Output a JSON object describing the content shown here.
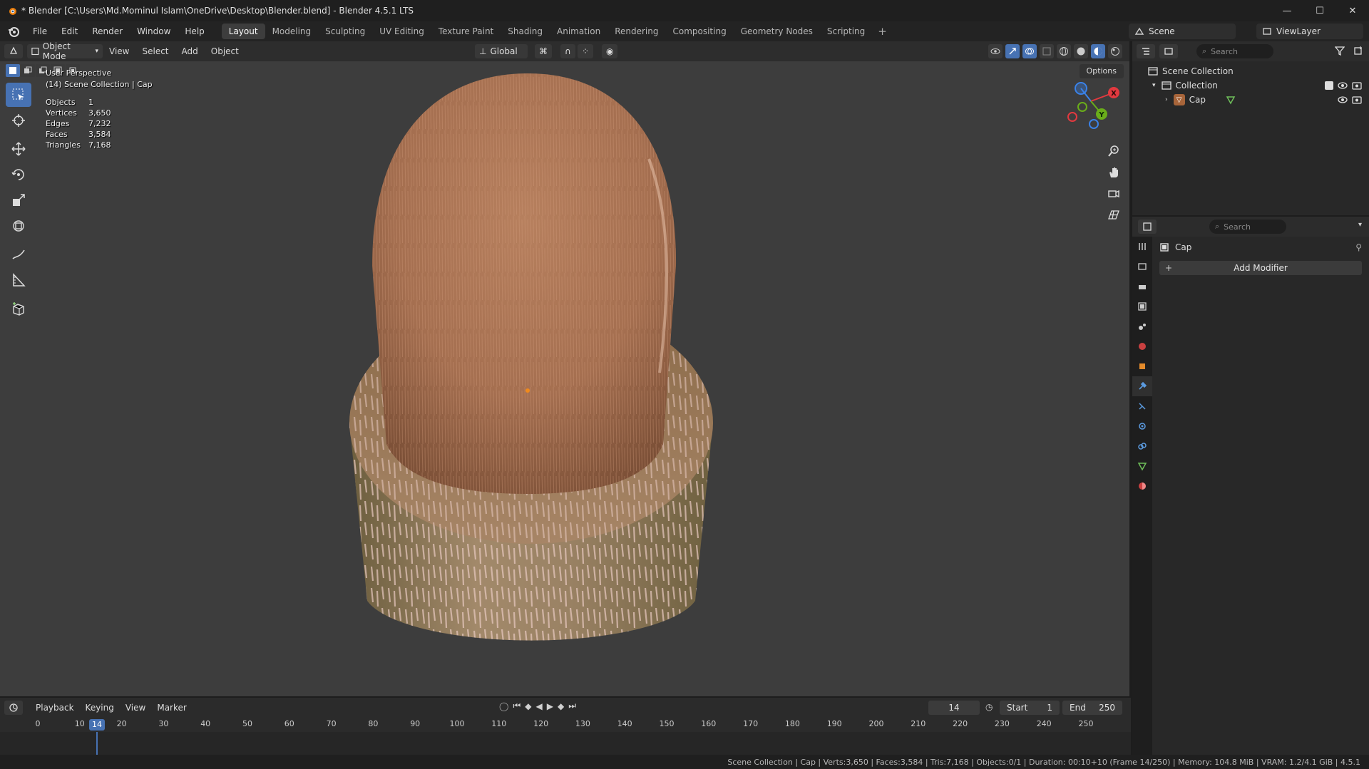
{
  "window": {
    "title": "* Blender [C:\\Users\\Md.Mominul Islam\\OneDrive\\Desktop\\Blender.blend] - Blender 4.5.1 LTS",
    "minimize": "—",
    "maximize": "☐",
    "close": "✕"
  },
  "menus": [
    "File",
    "Edit",
    "Render",
    "Window",
    "Help"
  ],
  "workspaces": [
    "Layout",
    "Modeling",
    "Sculpting",
    "UV Editing",
    "Texture Paint",
    "Shading",
    "Animation",
    "Rendering",
    "Compositing",
    "Geometry Nodes",
    "Scripting"
  ],
  "active_workspace": "Layout",
  "scene": "Scene",
  "view_layer": "ViewLayer",
  "viewport": {
    "mode": "Object Mode",
    "menus": [
      "View",
      "Select",
      "Add",
      "Object"
    ],
    "orientation": "Global",
    "options": "Options",
    "perspective": "User Perspective",
    "collection_info": "(14) Scene Collection | Cap",
    "stats": [
      {
        "label": "Objects",
        "value": "1"
      },
      {
        "label": "Vertices",
        "value": "3,650"
      },
      {
        "label": "Edges",
        "value": "7,232"
      },
      {
        "label": "Faces",
        "value": "3,584"
      },
      {
        "label": "Triangles",
        "value": "7,168"
      }
    ],
    "gizmo": {
      "x": "X",
      "y": "Y",
      "z": "Z"
    }
  },
  "outliner": {
    "search_placeholder": "Search",
    "scene_collection": "Scene Collection",
    "collection": "Collection",
    "object": "Cap"
  },
  "properties": {
    "search_placeholder": "Search",
    "object_name": "Cap",
    "add_modifier": "Add Modifier"
  },
  "timeline": {
    "menus": [
      "Playback",
      "Keying",
      "View",
      "Marker"
    ],
    "current_frame": "14",
    "start_label": "Start",
    "start": "1",
    "end_label": "End",
    "end": "250",
    "ticks": [
      "0",
      "10",
      "20",
      "30",
      "40",
      "50",
      "60",
      "70",
      "80",
      "90",
      "100",
      "110",
      "120",
      "130",
      "140",
      "150",
      "160",
      "170",
      "180",
      "190",
      "200",
      "210",
      "220",
      "230",
      "240",
      "250"
    ]
  },
  "status_bar": "Scene Collection | Cap | Verts:3,650 | Faces:3,584 | Tris:7,168 | Objects:0/1 | Duration: 00:10+10 (Frame 14/250) | Memory: 104.8 MiB | VRAM: 1.2/4.1 GiB |  4.5.1",
  "colors": {
    "accent": "#4772b3",
    "viewport_bg": "#3d3d3d",
    "axis_x": "#e2393f",
    "axis_y": "#6aad1a",
    "axis_z": "#3a82e8"
  }
}
